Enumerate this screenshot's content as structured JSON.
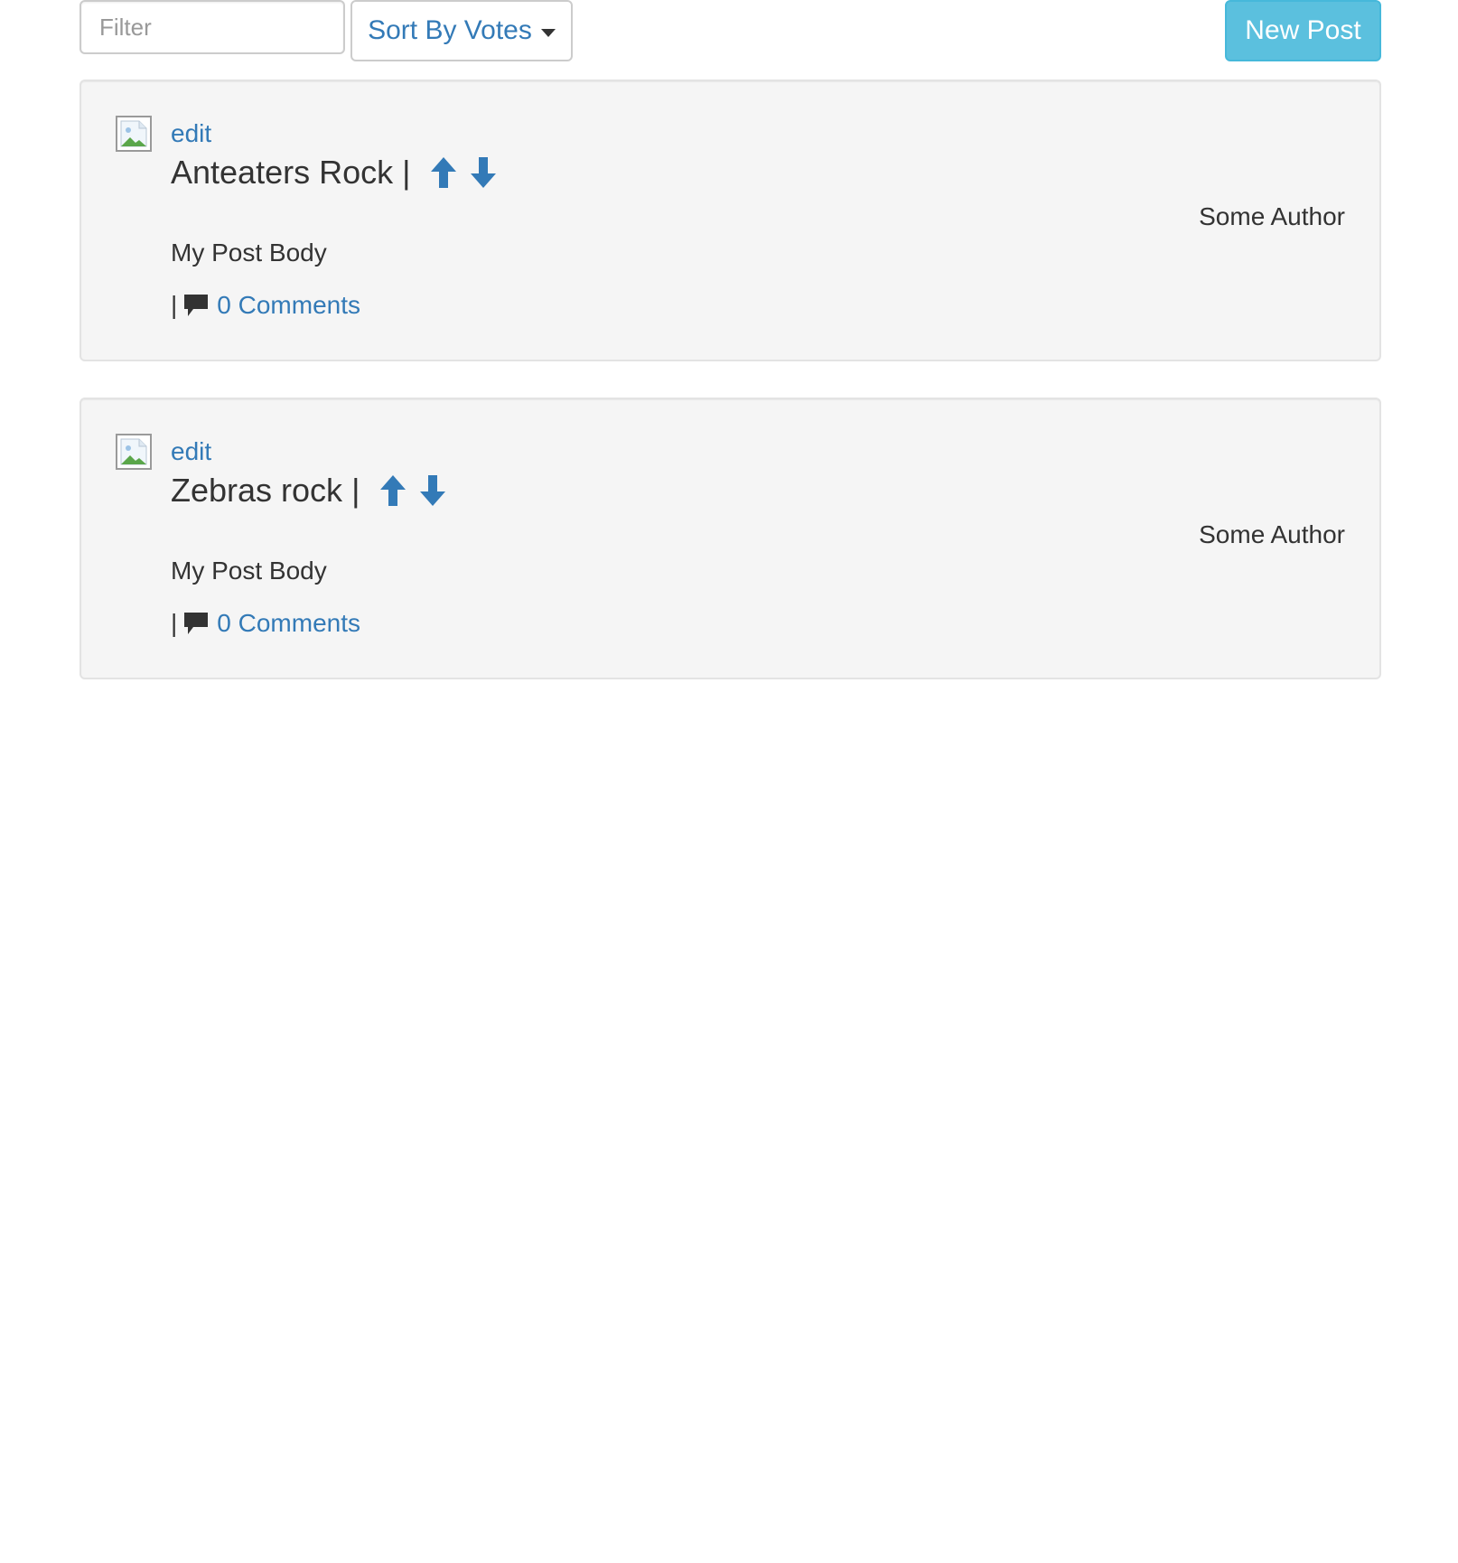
{
  "toolbar": {
    "filter_placeholder": "Filter",
    "filter_value": "",
    "sort_label": "Sort By Votes",
    "new_post_label": "New Post"
  },
  "posts": [
    {
      "edit_label": "edit",
      "title": "Anteaters Rock",
      "separator": "|",
      "author": "Some Author",
      "body": "My Post Body",
      "meta_separator": "|",
      "comments_label": "0 Comments"
    },
    {
      "edit_label": "edit",
      "title": "Zebras rock",
      "separator": "|",
      "author": "Some Author",
      "body": "My Post Body",
      "meta_separator": "|",
      "comments_label": "0 Comments"
    }
  ],
  "icons": {
    "thumbnail": "broken-image-icon",
    "upvote": "arrow-up-icon",
    "downvote": "arrow-down-icon",
    "comments": "comment-icon",
    "sort_caret": "caret-down-icon"
  },
  "colors": {
    "link": "#337ab7",
    "primary_button": "#5bc0de",
    "card_background": "#f5f5f5",
    "text": "#333333"
  }
}
